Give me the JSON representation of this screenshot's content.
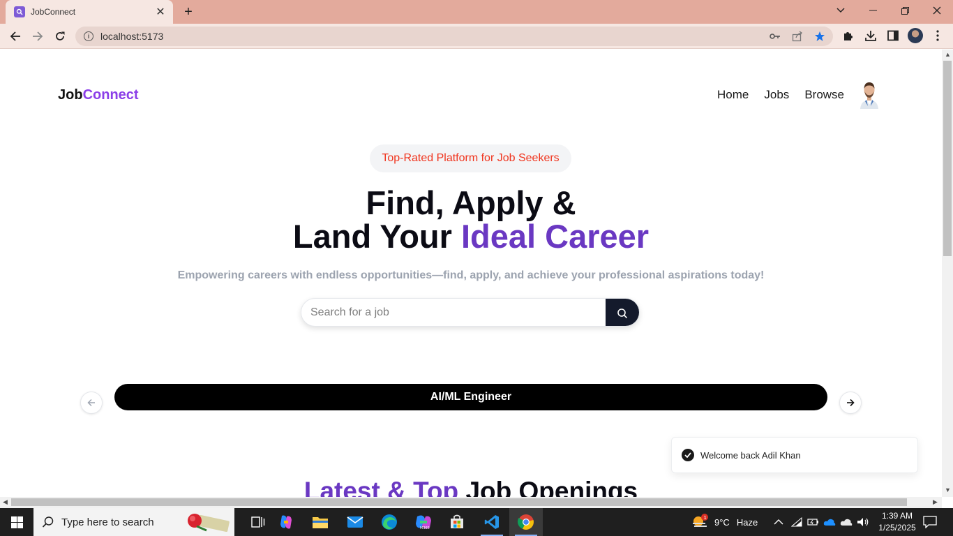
{
  "browser": {
    "tab_title": "JobConnect",
    "url": "localhost:5173"
  },
  "site": {
    "logo_part1": "Job",
    "logo_part2": "Connect",
    "nav": [
      "Home",
      "Jobs",
      "Browse"
    ]
  },
  "hero": {
    "badge": "Top-Rated Platform for Job Seekers",
    "title_line1": "Find, Apply &",
    "title_line2_prefix": "Land Your ",
    "title_line2_accent": "Ideal Career",
    "subtitle": "Empowering careers with endless opportunities—find, apply, and achieve your professional aspirations today!",
    "search_placeholder": "Search for a job"
  },
  "carousel": {
    "current_item": "AI/ML Engineer"
  },
  "section": {
    "title_accent": "Latest & Top",
    "title_rest": " Job Openings"
  },
  "toast": {
    "message": "Welcome back Adil Khan"
  },
  "taskbar": {
    "search_placeholder": "Type here to search",
    "weather_temp": "9°C",
    "weather_desc": "Haze",
    "weather_badge": "1",
    "time": "1:39 AM",
    "date": "1/25/2025"
  },
  "colors": {
    "accent_purple": "#6a38c2",
    "logo_purple": "#8b3fe8",
    "badge_text": "#f0331c",
    "tab_strip": "#e3aa9c"
  }
}
